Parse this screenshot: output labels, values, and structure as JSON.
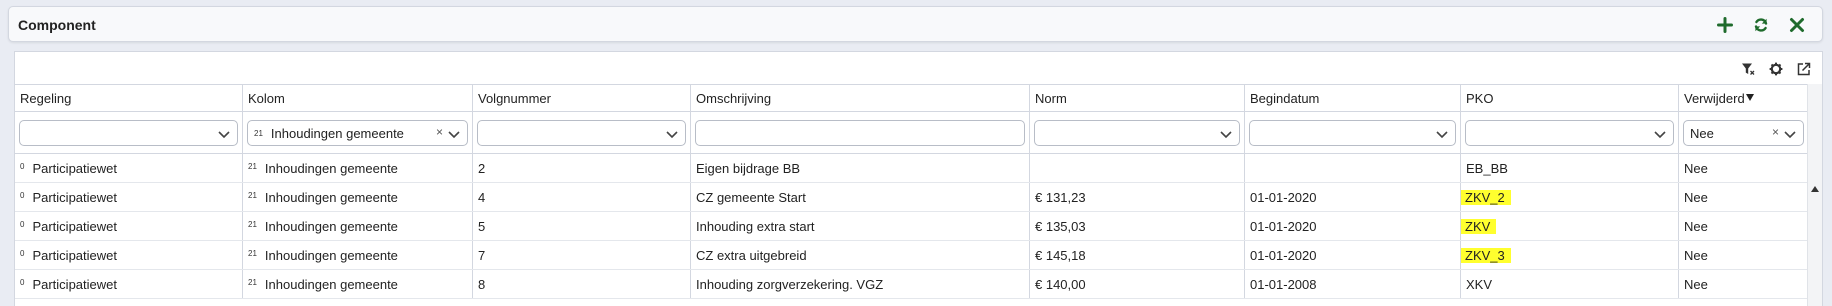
{
  "header": {
    "title": "Component",
    "actions": [
      {
        "name": "add-button",
        "icon": "plus-icon"
      },
      {
        "name": "refresh-button",
        "icon": "refresh-icon"
      },
      {
        "name": "close-button",
        "icon": "close-icon"
      }
    ]
  },
  "toolbar": {
    "icons": [
      "filter-clear-icon",
      "gear-icon",
      "export-icon"
    ]
  },
  "accent_color": "#1f6b2c",
  "highlight_color": "#ffff2e",
  "columns": [
    "Regeling",
    "Kolom",
    "Volgnummer",
    "Omschrijving",
    "Norm",
    "Begindatum",
    "PKO",
    "Verwijderd"
  ],
  "filters": {
    "regeling": "",
    "kolom_code": "21",
    "kolom_value": "Inhoudingen gemeente",
    "kolom_clear": "×",
    "volgnummer": "",
    "omschrijving": "",
    "norm": "",
    "begindatum": "",
    "pko": "",
    "verwijderd": "Nee",
    "verwijderd_clear": "×"
  },
  "rows": [
    {
      "regeling_code": "0",
      "regeling": "Participatiewet",
      "kolom_code": "21",
      "kolom": "Inhoudingen gemeente",
      "volgnummer": "2",
      "omschrijving": "Eigen bijdrage BB",
      "norm": "",
      "begindatum": "",
      "pko": "EB_BB",
      "verwijderd": "Nee",
      "pko_highlight": false
    },
    {
      "regeling_code": "0",
      "regeling": "Participatiewet",
      "kolom_code": "21",
      "kolom": "Inhoudingen gemeente",
      "volgnummer": "4",
      "omschrijving": "CZ gemeente Start",
      "norm": "€ 131,23",
      "begindatum": "01-01-2020",
      "pko": "ZKV_2",
      "verwijderd": "Nee",
      "pko_highlight": true
    },
    {
      "regeling_code": "0",
      "regeling": "Participatiewet",
      "kolom_code": "21",
      "kolom": "Inhoudingen gemeente",
      "volgnummer": "5",
      "omschrijving": "Inhouding extra start",
      "norm": "€ 135,03",
      "begindatum": "01-01-2020",
      "pko": "ZKV",
      "verwijderd": "Nee",
      "pko_highlight": true
    },
    {
      "regeling_code": "0",
      "regeling": "Participatiewet",
      "kolom_code": "21",
      "kolom": "Inhoudingen gemeente",
      "volgnummer": "7",
      "omschrijving": "CZ extra uitgebreid",
      "norm": "€ 145,18",
      "begindatum": "01-01-2020",
      "pko": "ZKV_3",
      "verwijderd": "Nee",
      "pko_highlight": true
    },
    {
      "regeling_code": "0",
      "regeling": "Participatiewet",
      "kolom_code": "21",
      "kolom": "Inhoudingen gemeente",
      "volgnummer": "8",
      "omschrijving": "Inhouding zorgverzekering. VGZ",
      "norm": "€ 140,00",
      "begindatum": "01-01-2008",
      "pko": "XKV",
      "verwijderd": "Nee",
      "pko_highlight": false
    }
  ]
}
